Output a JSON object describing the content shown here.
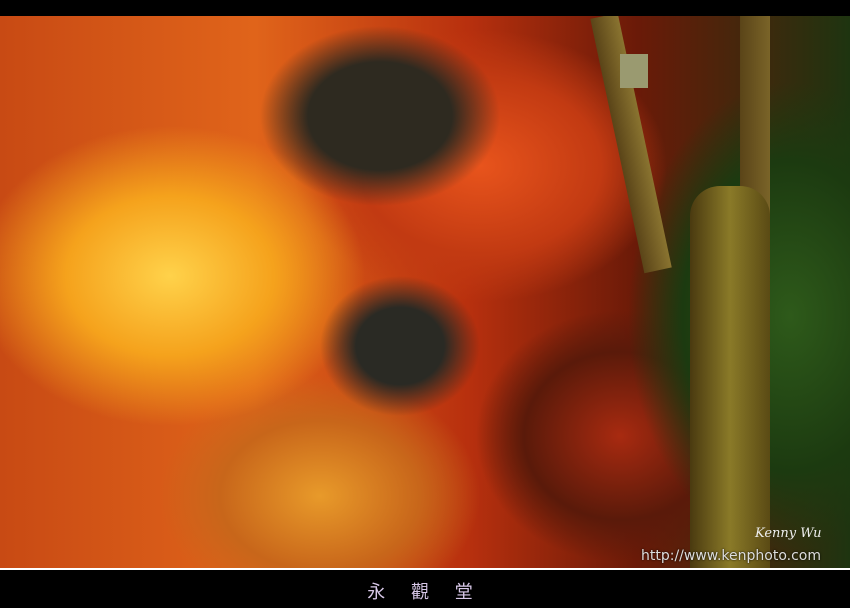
{
  "photo": {
    "signature": "Kenny Wu",
    "url": "http://www.kenphoto.com"
  },
  "caption": "永 觀 堂"
}
